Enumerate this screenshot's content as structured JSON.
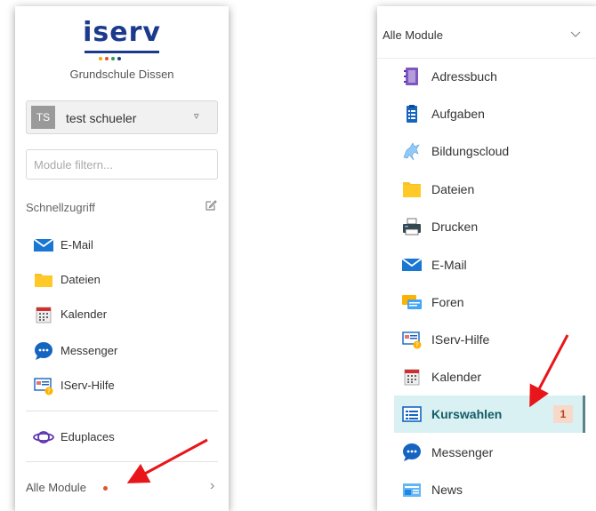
{
  "left": {
    "brand": "iserv",
    "school": "Grundschule Dissen",
    "user": {
      "initials": "TS",
      "name": "test schueler"
    },
    "filter_placeholder": "Module filtern...",
    "section_label": "Schnellzugriff",
    "quick_items": [
      {
        "label": "E-Mail",
        "icon": "mail-icon"
      },
      {
        "label": "Dateien",
        "icon": "folder-icon"
      },
      {
        "label": "Kalender",
        "icon": "calendar-icon"
      },
      {
        "label": "Messenger",
        "icon": "chat-bubble-icon"
      },
      {
        "label": "IServ-Hilfe",
        "icon": "help-icon"
      }
    ],
    "extra_items": [
      {
        "label": "Eduplaces",
        "icon": "planet-icon"
      }
    ],
    "all_modules": "Alle Module"
  },
  "right": {
    "title": "Alle Module",
    "items": [
      {
        "label": "Adressbuch",
        "icon": "address-book-icon"
      },
      {
        "label": "Aufgaben",
        "icon": "clipboard-icon"
      },
      {
        "label": "Bildungscloud",
        "icon": "horse-icon"
      },
      {
        "label": "Dateien",
        "icon": "folder-icon"
      },
      {
        "label": "Drucken",
        "icon": "printer-icon"
      },
      {
        "label": "E-Mail",
        "icon": "mail-icon"
      },
      {
        "label": "Foren",
        "icon": "forum-icon"
      },
      {
        "label": "IServ-Hilfe",
        "icon": "help-icon"
      },
      {
        "label": "Kalender",
        "icon": "calendar-icon"
      },
      {
        "label": "Kurswahlen",
        "icon": "course-icon",
        "active": true,
        "badge": "1"
      },
      {
        "label": "Messenger",
        "icon": "chat-bubble-icon"
      },
      {
        "label": "News",
        "icon": "news-icon"
      }
    ]
  },
  "colors": {
    "brand_blue": "#1c3a8c",
    "active_bg": "#d9f1f3",
    "active_text": "#135c66",
    "badge_bg": "#f7d8c9",
    "notification_dot": "#e2542a",
    "arrow_red": "#e8151a"
  }
}
